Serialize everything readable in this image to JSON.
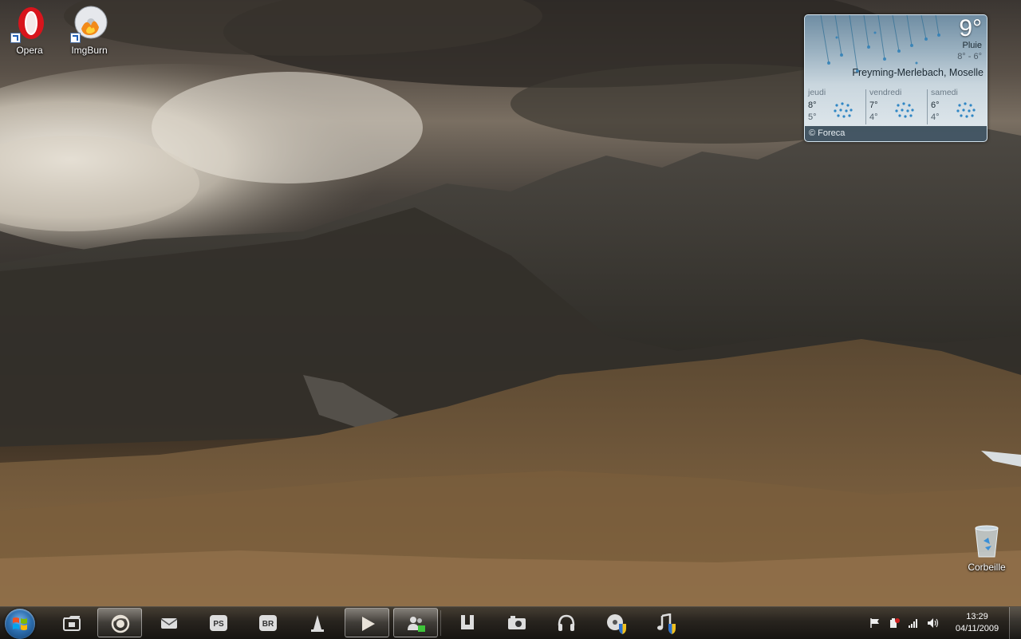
{
  "desktop": {
    "icons": [
      {
        "label": "Opera",
        "icon": "opera-icon"
      },
      {
        "label": "ImgBurn",
        "icon": "imgburn-icon"
      },
      {
        "label": "Corbeille",
        "icon": "recycle-bin-icon"
      }
    ]
  },
  "weather": {
    "temperature": "9°",
    "condition": "Pluie",
    "range": "8° - 6°",
    "location": "Freyming-Merlebach, Moselle",
    "forecast": [
      {
        "day": "jeudi",
        "high": "8°",
        "low": "5°",
        "icon": "rain-icon"
      },
      {
        "day": "vendredi",
        "high": "7°",
        "low": "4°",
        "icon": "rain-icon"
      },
      {
        "day": "samedi",
        "high": "6°",
        "low": "4°",
        "icon": "rain-icon"
      }
    ],
    "credit": "© Foreca"
  },
  "taskbar": {
    "buttons": [
      {
        "name": "explorer",
        "icon": "folder-icon"
      },
      {
        "name": "firefox",
        "icon": "firefox-icon"
      },
      {
        "name": "mail",
        "icon": "mail-icon"
      },
      {
        "name": "photoshop",
        "icon": "ps-icon",
        "text": "PS"
      },
      {
        "name": "bridge",
        "icon": "br-icon",
        "text": "BR"
      },
      {
        "name": "vlc",
        "icon": "cone-icon"
      },
      {
        "name": "media-player",
        "icon": "play-icon"
      },
      {
        "name": "messenger",
        "icon": "messenger-icon"
      },
      {
        "name": "utorrent",
        "icon": "utorrent-icon"
      },
      {
        "name": "camera",
        "icon": "camera-icon"
      },
      {
        "name": "headphones",
        "icon": "headphones-icon"
      },
      {
        "name": "disc-shield",
        "icon": "disc-shield-icon"
      },
      {
        "name": "music-shield",
        "icon": "music-shield-icon"
      }
    ]
  },
  "tray": {
    "time": "13:29",
    "date": "04/11/2009",
    "icons": [
      "flag-icon",
      "power-icon",
      "network-icon",
      "volume-icon"
    ]
  }
}
